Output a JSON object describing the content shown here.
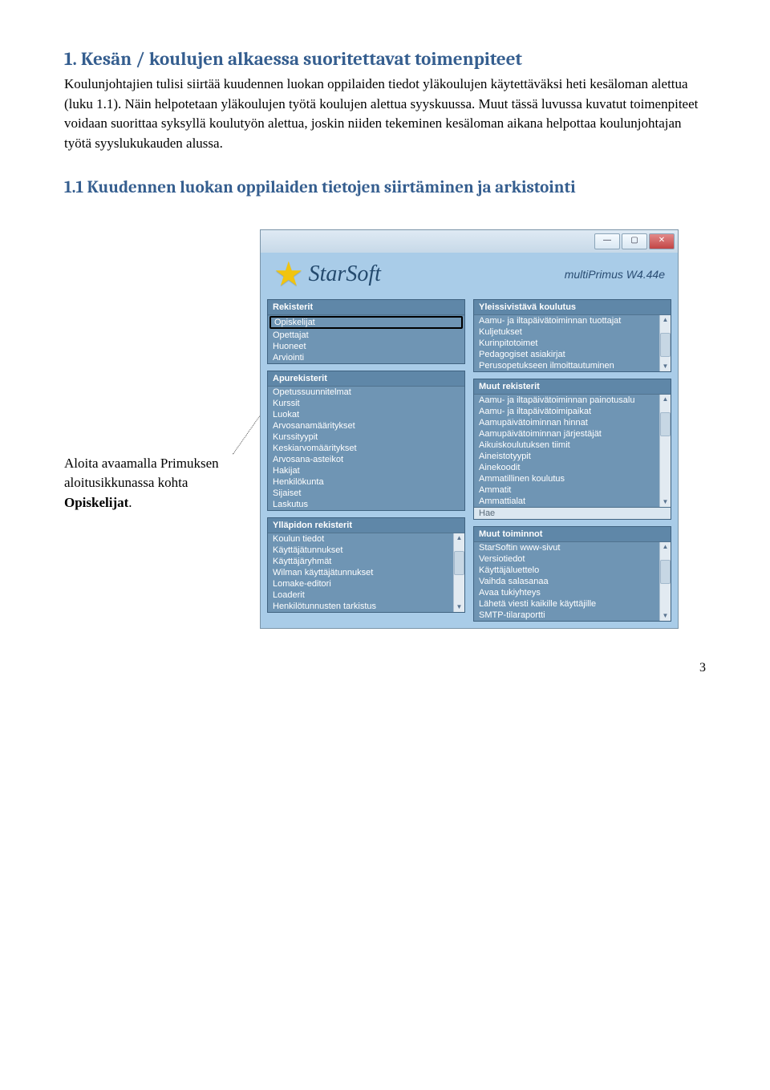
{
  "heading": "1.  Kesän / koulujen alkaessa suoritettavat toimenpiteet",
  "paragraph": "Koulunjohtajien tulisi siirtää kuudennen luokan oppilaiden tiedot yläkoulujen käytettäväksi heti kesäloman alettua (luku 1.1). Näin helpotetaan yläkoulujen työtä koulujen alettua syyskuussa. Muut tässä luvussa kuvatut toimenpiteet voidaan suorittaa syksyllä koulutyön alettua, joskin niiden tekeminen kesäloman aikana helpottaa koulunjohtajan työtä syyslukukauden alussa.",
  "subheading": "1.1    Kuudennen luokan oppilaiden tietojen siirtäminen ja arkistointi",
  "caption_line1": "Aloita avaamalla Primuksen",
  "caption_line2_pre": "aloitusikkunassa kohta ",
  "caption_line2_b": "Opiskelijat",
  "caption_line2_post": ".",
  "window": {
    "brand": "StarSoft",
    "version": "multiPrimus W4.44e",
    "min": "—",
    "max": "▢",
    "close": "✕",
    "panels": {
      "rekisterit": {
        "title": "Rekisterit",
        "items": [
          "Opiskelijat",
          "Opettajat",
          "Huoneet",
          "Arviointi"
        ]
      },
      "yleissivistava": {
        "title": "Yleissivistävä koulutus",
        "items": [
          "Aamu- ja iltapäivätoiminnan tuottajat",
          "Kuljetukset",
          "Kurinpitotoimet",
          "Pedagogiset asiakirjat",
          "Perusopetukseen ilmoittautuminen"
        ]
      },
      "apurekisterit": {
        "title": "Apurekisterit",
        "items": [
          "Opetussuunnitelmat",
          "Kurssit",
          "Luokat",
          "Arvosanamääritykset",
          "Kurssityypit",
          "Keskiarvomääritykset",
          "Arvosana-asteikot",
          "Hakijat",
          "Henkilökunta",
          "Sijaiset",
          "Laskutus"
        ]
      },
      "muutrek": {
        "title": "Muut rekisterit",
        "items": [
          "Aamu- ja iltapäivätoiminnan painotusalu",
          "Aamu- ja iltapäivätoimipaikat",
          "Aamupäivätoiminnan hinnat",
          "Aamupäivätoiminnan järjestäjät",
          "Aikuiskoulutuksen tiimit",
          "Aineistotyypit",
          "Ainekoodit",
          "Ammatillinen koulutus",
          "Ammatit",
          "Ammattialat"
        ],
        "hae": "Hae"
      },
      "yllapidon": {
        "title": "Ylläpidon rekisterit",
        "items": [
          "Koulun tiedot",
          "Käyttäjätunnukset",
          "Käyttäjäryhmät",
          "Wilman käyttäjätunnukset",
          "Lomake-editori",
          "Loaderit",
          "Henkilötunnusten tarkistus"
        ]
      },
      "muuttoim": {
        "title": "Muut toiminnot",
        "items": [
          "StarSoftin www-sivut",
          "Versiotiedot",
          "Käyttäjäluettelo",
          "Vaihda salasanaa",
          "Avaa tukiyhteys",
          "Lähetä viesti kaikille käyttäjille",
          "SMTP-tilaraportti"
        ]
      }
    }
  },
  "page_number": "3"
}
